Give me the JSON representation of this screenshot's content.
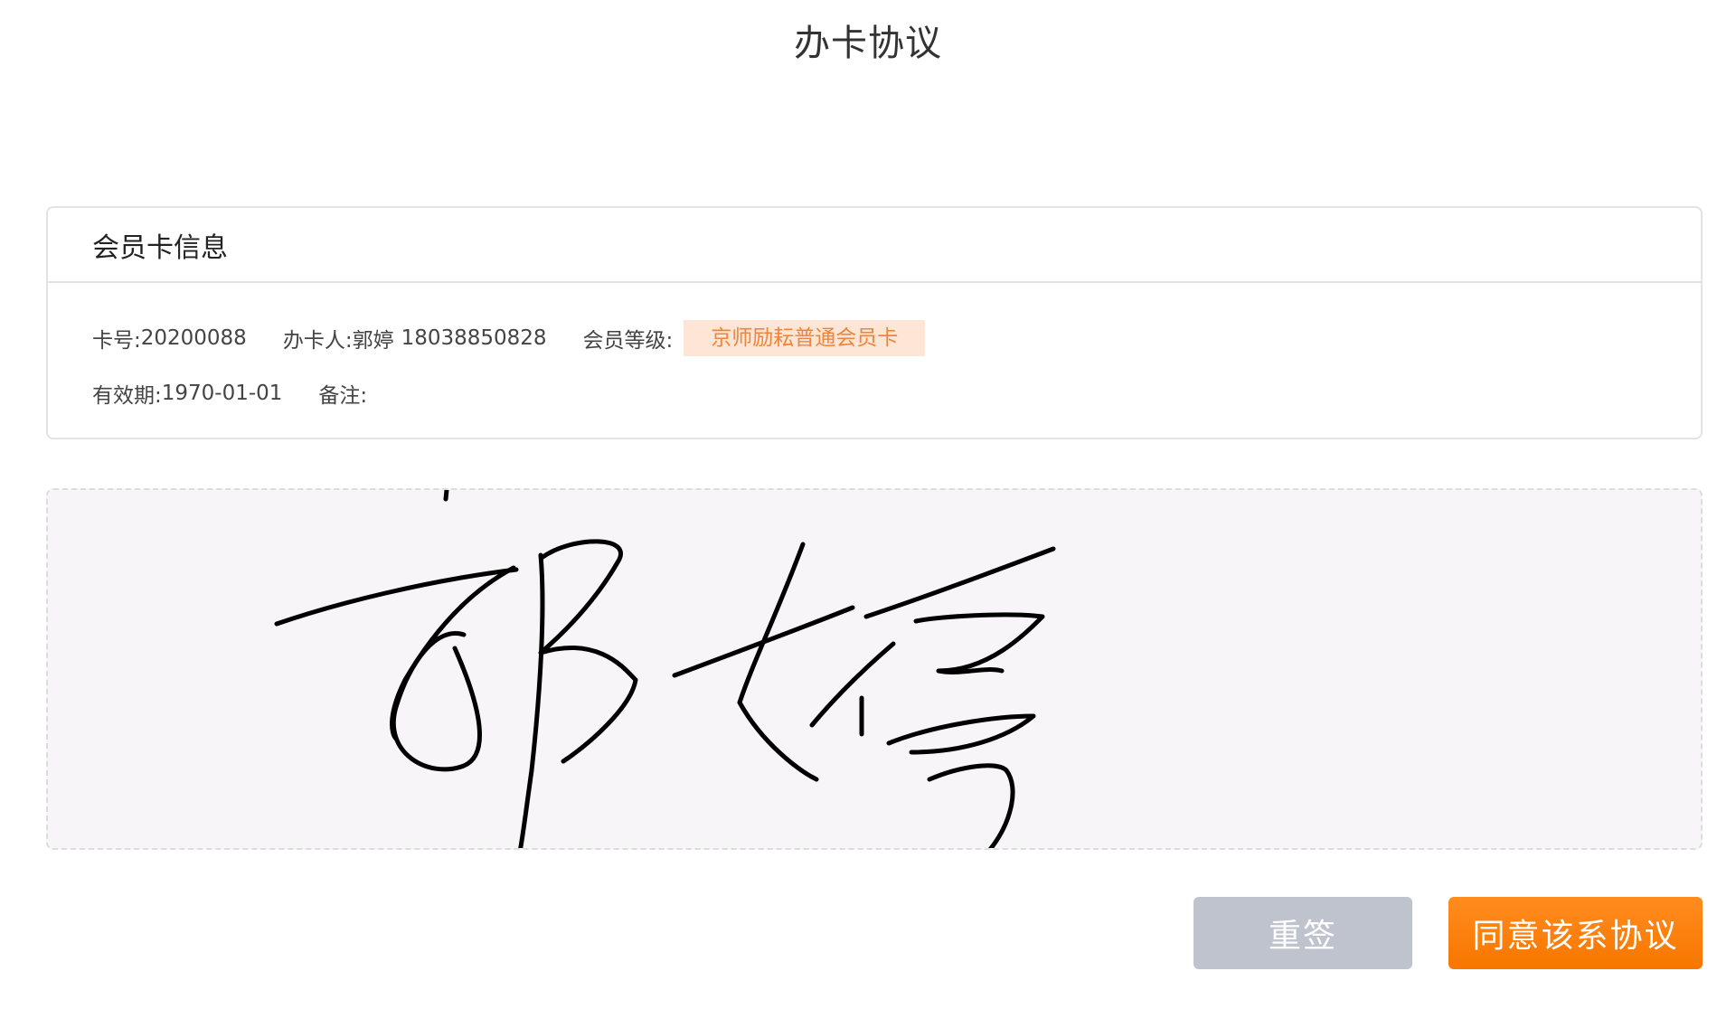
{
  "header": {
    "title": "办卡协议"
  },
  "card_info": {
    "section_title": "会员卡信息",
    "card_number_label": "卡号:",
    "card_number": "20200088",
    "holder_label": "办卡人:",
    "holder_name": "郭婷",
    "holder_phone": "18038850828",
    "level_label": "会员等级:",
    "level_value": "京师励耘普通会员卡",
    "validity_label": "有效期:",
    "validity_value": "1970-01-01",
    "remark_label": "备注:",
    "remark_value": ""
  },
  "signature": {
    "signed_name": "郭婷",
    "stroke_color": "#000000"
  },
  "actions": {
    "resign_label": "重签",
    "agree_label": "同意该系协议"
  },
  "colors": {
    "accent_orange": "#f77600",
    "badge_background": "#fde6d6",
    "badge_text": "#f0843a",
    "disabled_button": "#bfc3cd",
    "signature_background": "#f7f5f7"
  }
}
